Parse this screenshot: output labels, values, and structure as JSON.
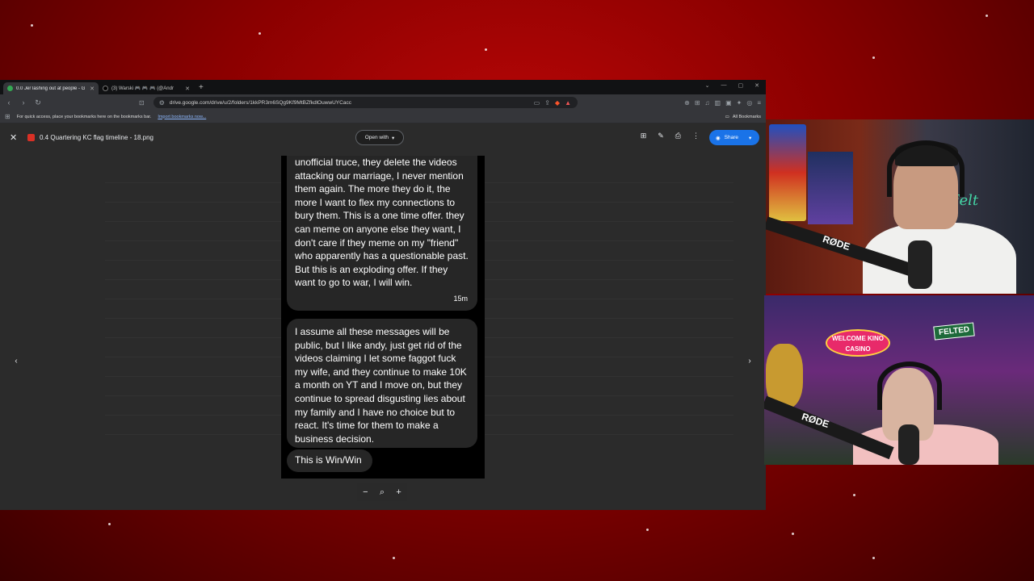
{
  "browser": {
    "tabs": [
      {
        "title": "0.0 Jer lashing out at people - G",
        "active": true
      },
      {
        "title": "(3) Warski 🎮 🎮 🎮 (@Andr",
        "active": false
      }
    ],
    "address": "drive.google.com/drive/u/2/folders/1kkPR3m6SQg9Kf9MtBZfkdlOuwwUYCacc",
    "bookmarks_hint": "For quick access, place your bookmarks here on the bookmarks bar.",
    "bookmarks_link": "Import bookmarks now...",
    "all_bookmarks": "All Bookmarks"
  },
  "viewer": {
    "file_name": "0.4 Quartering KC flag timeline - 18.png",
    "open_with": "Open with",
    "share": "Share"
  },
  "chat": {
    "message1": "unofficial truce, they delete the videos attacking our marriage, I never mention them again.  The more they do it, the more I want to flex my connections to bury them.  This is a one time offer.  they can meme on anyone else they want, I don't care if they meme on my \"friend\" who apparently has a questionable past.  But this is an exploding offer.  If they want to go to war, I will win.",
    "message1_time": "15m",
    "message2": "I assume all these messages will be public, but I like andy, just get rid of the videos claiming I let some faggot fuck my wife, and they continue to make 10K a month on YT and I move on, but they continue to spread disgusting lies about my family and I have no choice but to react.  It's time for them to make a business decision.",
    "message3": "This is Win/Win"
  },
  "webcam": {
    "top_rode": "RØDE",
    "bottom_rode": "RØDE",
    "neon_sign": "Felt",
    "casino_sign": "WELCOME KINO CASINO",
    "felted_sign": "FELTED"
  },
  "colors": {
    "share_blue": "#1a73e8",
    "background_red": "#a00000"
  }
}
